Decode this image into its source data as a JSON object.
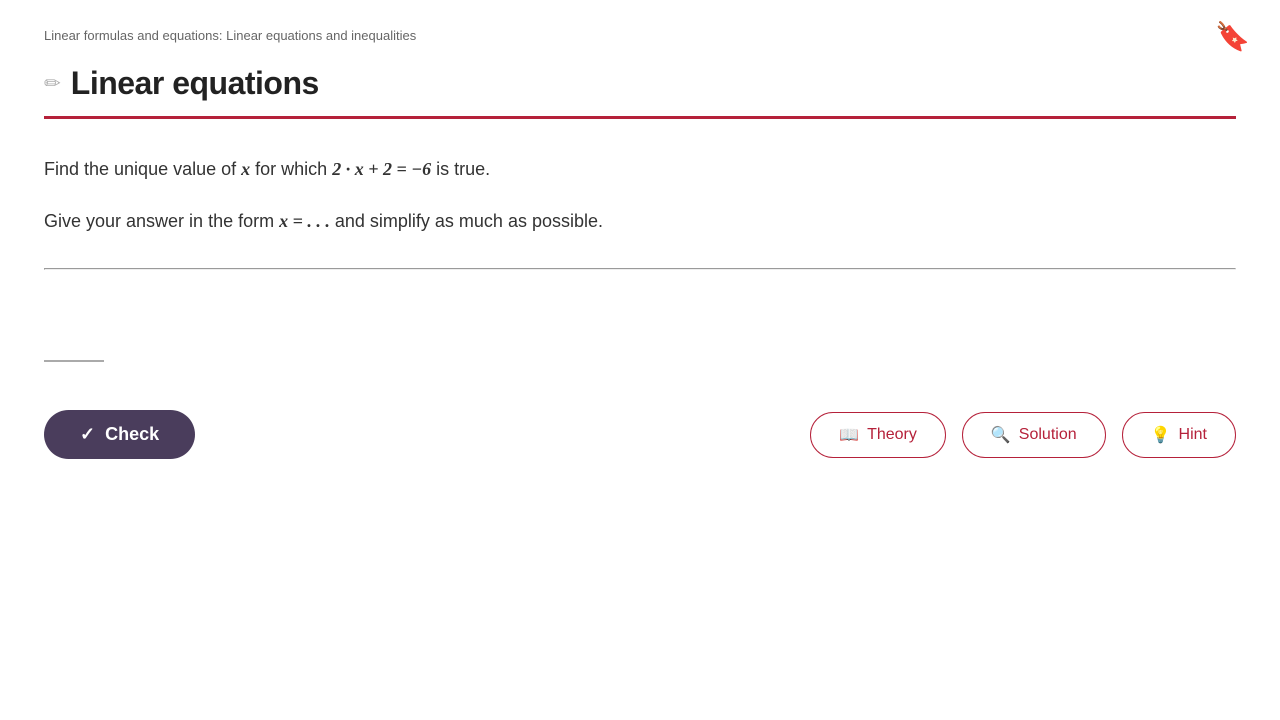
{
  "breadcrumb": {
    "text": "Linear formulas and equations: Linear equations and inequalities"
  },
  "header": {
    "title": "Linear equations",
    "pencil_icon": "✏"
  },
  "bookmark_icon": "🔖",
  "problem": {
    "line1_prefix": "Find the unique value of ",
    "line1_var": "x",
    "line1_suffix": " for which ",
    "line1_equation": "2 · x + 2 = −6",
    "line1_end": " is true.",
    "line2_prefix": "Give your answer in the form ",
    "line2_form": "x = . . .",
    "line2_suffix": " and simplify as much as possible."
  },
  "answer": {
    "placeholder": "",
    "current_value": ""
  },
  "actions": {
    "check_label": "Check",
    "check_icon": "✓",
    "theory_label": "Theory",
    "theory_icon": "📖",
    "solution_label": "Solution",
    "solution_icon": "🔍",
    "hint_label": "Hint",
    "hint_icon": "💡"
  }
}
